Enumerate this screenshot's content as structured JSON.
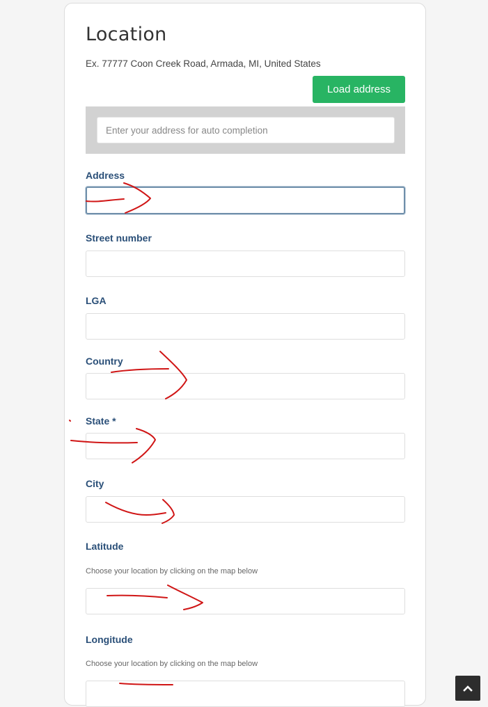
{
  "location": {
    "title": "Location",
    "example": "Ex. 77777 Coon Creek Road, Armada, MI, United States",
    "load_address_label": "Load address",
    "autocomplete_placeholder": "Enter your address for auto completion"
  },
  "fields": {
    "address": {
      "label": "Address",
      "value": ""
    },
    "street_number": {
      "label": "Street number",
      "value": ""
    },
    "lga": {
      "label": "LGA",
      "value": ""
    },
    "country": {
      "label": "Country",
      "value": ""
    },
    "state": {
      "label": "State *",
      "value": ""
    },
    "city": {
      "label": "City",
      "value": ""
    },
    "latitude": {
      "label": "Latitude",
      "hint": "Choose your location by clicking on the map below",
      "value": ""
    },
    "longitude": {
      "label": "Longitude",
      "hint": "Choose your location by clicking on the map below",
      "value": ""
    }
  },
  "colors": {
    "accent_button": "#28b463",
    "label_text": "#2a4f78",
    "annotation_ink": "#d01515"
  },
  "icons": {
    "scroll_top": "chevron-up-icon"
  }
}
